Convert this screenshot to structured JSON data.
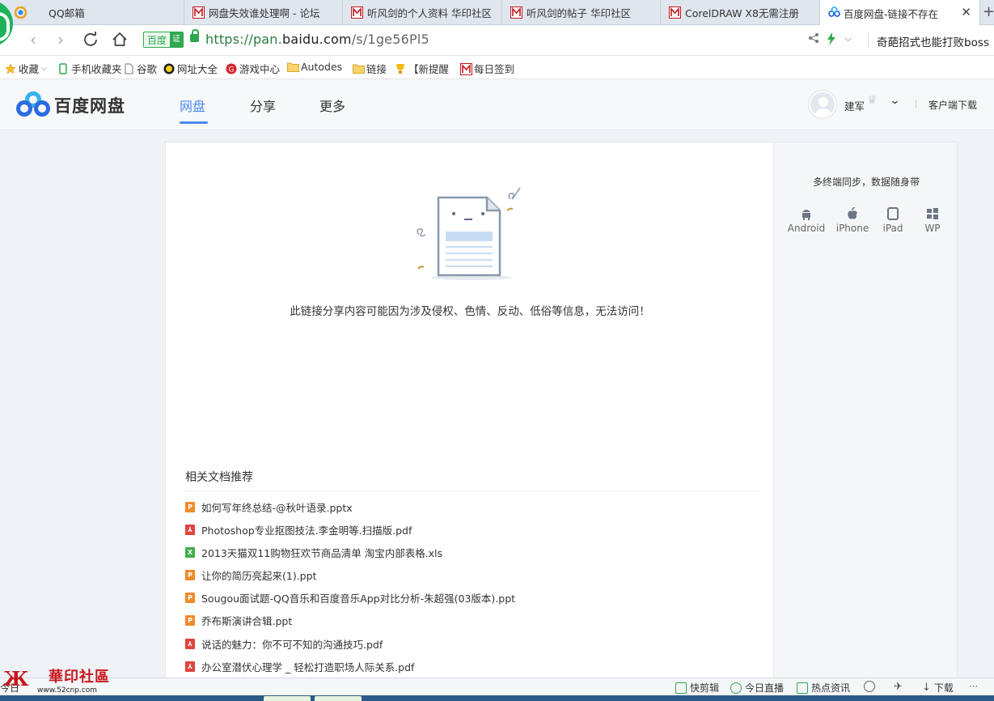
{
  "tabs": [
    {
      "title": "QQ邮箱",
      "icon": "qq-mail-icon",
      "active": false
    },
    {
      "title": "网盘失效谁处理啊 - 论坛",
      "icon": "huayin-icon",
      "active": false
    },
    {
      "title": "听风剑的个人资料 华印社区",
      "icon": "huayin-icon",
      "active": false
    },
    {
      "title": "听风剑的帖子 华印社区",
      "icon": "huayin-icon",
      "active": false
    },
    {
      "title": "CorelDRAW X8无需注册",
      "icon": "huayin-icon",
      "active": false
    },
    {
      "title": "百度网盘-链接不存在",
      "icon": "baidu-pan-icon",
      "active": true
    }
  ],
  "address": {
    "cert_label": "百度",
    "cert_badge": "证",
    "url_scheme": "https://pan.",
    "url_domain": "baidu.com",
    "url_path": "/s/1ge56Pl5",
    "search_hint": "奇葩招式也能打败boss"
  },
  "bookmarks": [
    {
      "label": "收藏",
      "icon": "star-icon"
    },
    {
      "label": "手机收藏夹",
      "icon": "phone-icon"
    },
    {
      "label": "谷歌",
      "icon": "page-icon"
    },
    {
      "label": "网址大全",
      "icon": "web-guide-icon"
    },
    {
      "label": "游戏中心",
      "icon": "game-icon"
    },
    {
      "label": "Autodes",
      "icon": "folder-icon"
    },
    {
      "label": "链接",
      "icon": "folder-icon"
    },
    {
      "label": "【新提醒",
      "icon": "trophy-icon"
    },
    {
      "label": "每日签到",
      "icon": "huayin-icon"
    }
  ],
  "baidu": {
    "logo_text": "百度网盘",
    "nav": [
      "网盘",
      "分享",
      "更多"
    ],
    "active_nav": "网盘",
    "username": "建军",
    "client_download": "客户端下载"
  },
  "main": {
    "message": "此链接分享内容可能因为涉及侵权、色情、反动、低俗等信息，无法访问！",
    "related_title": "相关文档推荐",
    "docs": [
      {
        "name": "如何写年终总结-@秋叶语录.pptx",
        "type": "ppt"
      },
      {
        "name": "Photoshop专业抠图技法.李金明等.扫描版.pdf",
        "type": "pdf"
      },
      {
        "name": "2013天猫双11购物狂欢节商品清单 淘宝内部表格.xls",
        "type": "xls"
      },
      {
        "name": "让你的简历亮起来(1).ppt",
        "type": "ppt"
      },
      {
        "name": "Sougou面试题-QQ音乐和百度音乐App对比分析-朱超强(03版本).ppt",
        "type": "ppt"
      },
      {
        "name": "乔布斯演讲合辑.ppt",
        "type": "ppt"
      },
      {
        "name": "说话的魅力：你不可不知的沟通技巧.pdf",
        "type": "pdf"
      },
      {
        "name": "办公室潜伏心理学 _ 轻松打造职场人际关系.pdf",
        "type": "pdf"
      }
    ],
    "file_badges": {
      "ppt": "P",
      "pdf": "⅄",
      "xls": "X"
    }
  },
  "side": {
    "title": "多终端同步，数据随身带",
    "platforms": [
      {
        "label": "Android",
        "icon": "android-icon"
      },
      {
        "label": "iPhone",
        "icon": "apple-icon"
      },
      {
        "label": "iPad",
        "icon": "ipad-icon"
      },
      {
        "label": "WP",
        "icon": "windows-icon"
      }
    ]
  },
  "statusbar": {
    "left_fragment": "今日",
    "items": [
      "快剪辑",
      "今日直播",
      "热点资讯",
      "下载"
    ]
  },
  "watermark": {
    "brand": "華印社區",
    "url": "www.52cnp.com"
  },
  "colors": {
    "accent": "#4a8bf0",
    "secure_green": "#2fa84f",
    "ppt": "#f08a2a",
    "pdf": "#e0443d",
    "xls": "#3fae49"
  }
}
